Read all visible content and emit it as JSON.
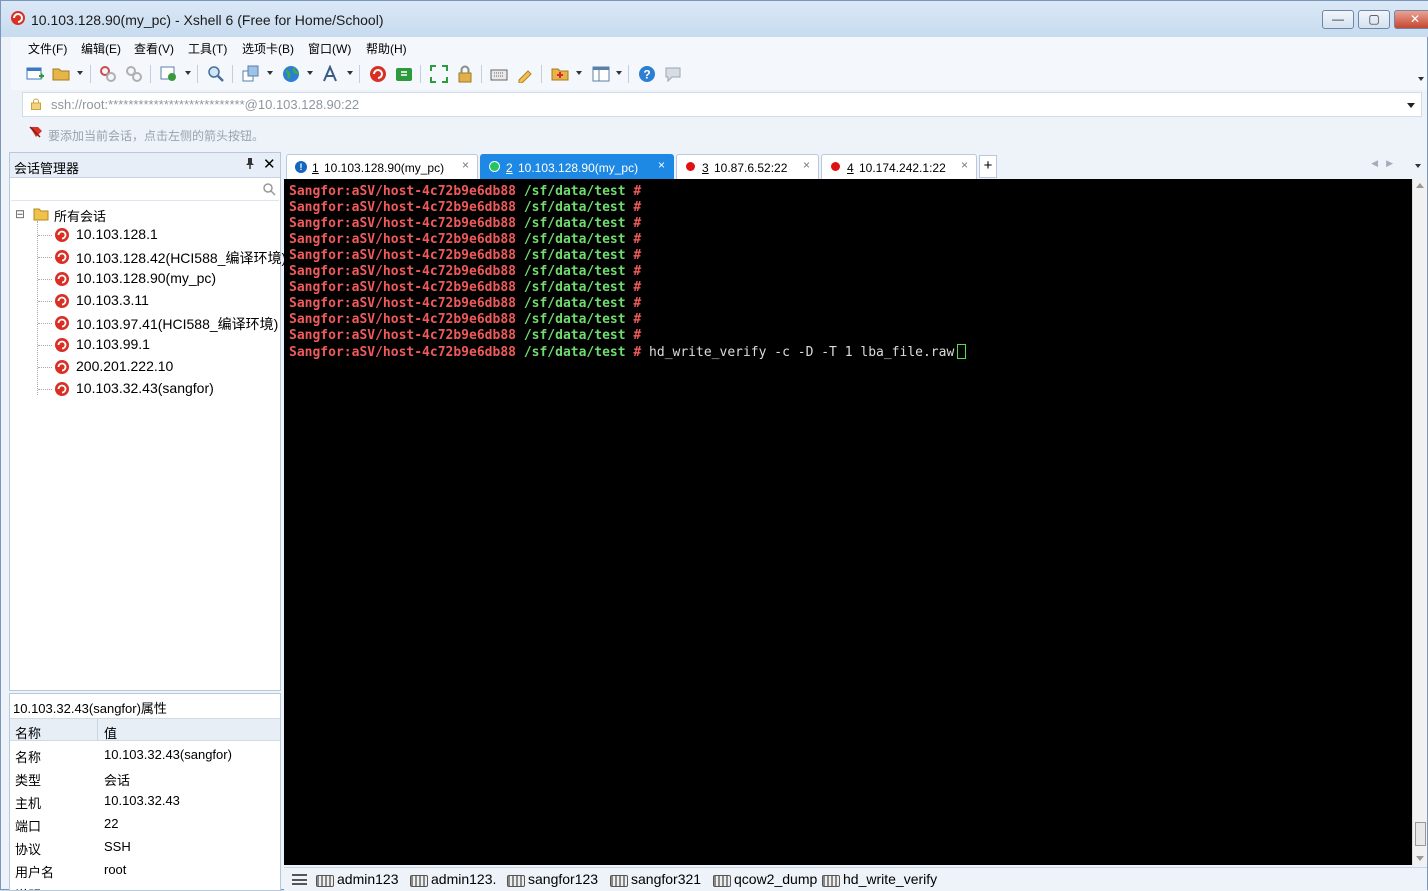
{
  "window": {
    "title": "10.103.128.90(my_pc) - Xshell 6 (Free for Home/School)",
    "controls": {
      "minimize": "—",
      "maximize": "▢",
      "close": "✕"
    }
  },
  "menu": [
    "文件(F)",
    "编辑(E)",
    "查看(V)",
    "工具(T)",
    "选项卡(B)",
    "窗口(W)",
    "帮助(H)"
  ],
  "toolbar": {
    "icons": [
      "new-session-icon",
      "open-folder-icon",
      "connect-icon",
      "disconnect-icon",
      "properties-icon",
      "find-icon",
      "transfer-icon",
      "globe-icon",
      "font-icon",
      "xshell-icon",
      "xftp-icon",
      "fullscreen-icon",
      "lock-icon",
      "keyboard-icon",
      "highlight-icon",
      "compose-icon",
      "layout-icon",
      "help-icon",
      "chat-icon"
    ]
  },
  "address": {
    "value": "ssh://root:***************************@10.103.128.90:22"
  },
  "hint": {
    "text": "要添加当前会话，点击左侧的箭头按钮。"
  },
  "session_manager": {
    "title": "会话管理器",
    "pin": "📌",
    "close": "✕",
    "root_label": "所有会话",
    "root_toggle": "⊟",
    "sessions": [
      "10.103.128.1",
      "10.103.128.42(HCI588_编译环境)",
      "10.103.128.90(my_pc)",
      "10.103.3.11",
      "10.103.97.41(HCI588_编译环境)",
      "10.103.99.1",
      "200.201.222.10",
      "10.103.32.43(sangfor)"
    ]
  },
  "properties": {
    "title": "10.103.32.43(sangfor)属性",
    "col_name": "名称",
    "col_value": "值",
    "rows": [
      {
        "k": "名称",
        "v": "10.103.32.43(sangfor)"
      },
      {
        "k": "类型",
        "v": "会话"
      },
      {
        "k": "主机",
        "v": "10.103.32.43"
      },
      {
        "k": "端口",
        "v": "22"
      },
      {
        "k": "协议",
        "v": "SSH"
      },
      {
        "k": "用户名",
        "v": "root"
      },
      {
        "k": "说明",
        "v": ""
      }
    ]
  },
  "tabs": [
    {
      "num": "1",
      "label": "10.103.128.90(my_pc)",
      "status": "warning",
      "color": "#1565c0",
      "active": false
    },
    {
      "num": "2",
      "label": "10.103.128.90(my_pc)",
      "status": "connected",
      "color": "#22c55e",
      "active": true
    },
    {
      "num": "3",
      "label": "10.87.6.52:22",
      "status": "disconnected",
      "color": "#e01010",
      "active": false
    },
    {
      "num": "4",
      "label": "10.174.242.1:22",
      "status": "disconnected",
      "color": "#e01010",
      "active": false
    }
  ],
  "tab_close": "×",
  "tab_add": "+",
  "terminal": {
    "prompt_host": "Sangfor:aSV/host-4c72b9e6db88",
    "prompt_path": "/sf/data/test",
    "prompt_hash": "#",
    "empty_prompt_count": 10,
    "command": "hd_write_verify -c -D -T 1 lba_file.raw"
  },
  "quick_commands": [
    "admin123",
    "admin123.",
    "sangfor123",
    "sangfor321",
    "qcow2_dump",
    "hd_write_verify"
  ],
  "colors": {
    "accent": "#1e88e5",
    "terminal_bg": "#000000",
    "prompt_red": "#f05a5a",
    "prompt_green": "#6fdc6f"
  }
}
